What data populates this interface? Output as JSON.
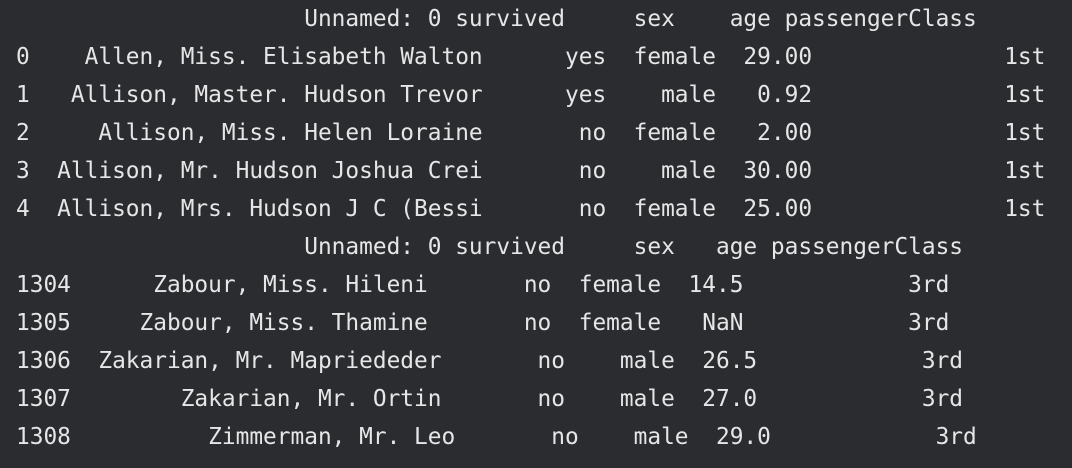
{
  "head_frame": {
    "header": "                     Unnamed: 0 survived     sex    age passengerClass",
    "rows": [
      "0    Allen, Miss. Elisabeth Walton      yes  female  29.00              1st",
      "1   Allison, Master. Hudson Trevor      yes    male   0.92              1st",
      "2     Allison, Miss. Helen Loraine       no  female   2.00              1st",
      "3  Allison, Mr. Hudson Joshua Crei       no    male  30.00              1st",
      "4  Allison, Mrs. Hudson J C (Bessi       no  female  25.00              1st"
    ]
  },
  "tail_frame": {
    "header": "                     Unnamed: 0 survived     sex   age passengerClass",
    "rows": [
      "1304      Zabour, Miss. Hileni       no  female  14.5            3rd",
      "1305     Zabour, Miss. Thamine       no  female   NaN            3rd",
      "1306  Zakarian, Mr. Mapriededer       no    male  26.5            3rd",
      "1307        Zakarian, Mr. Ortin       no    male  27.0            3rd",
      "1308          Zimmerman, Mr. Leo       no    male  29.0            3rd"
    ]
  }
}
